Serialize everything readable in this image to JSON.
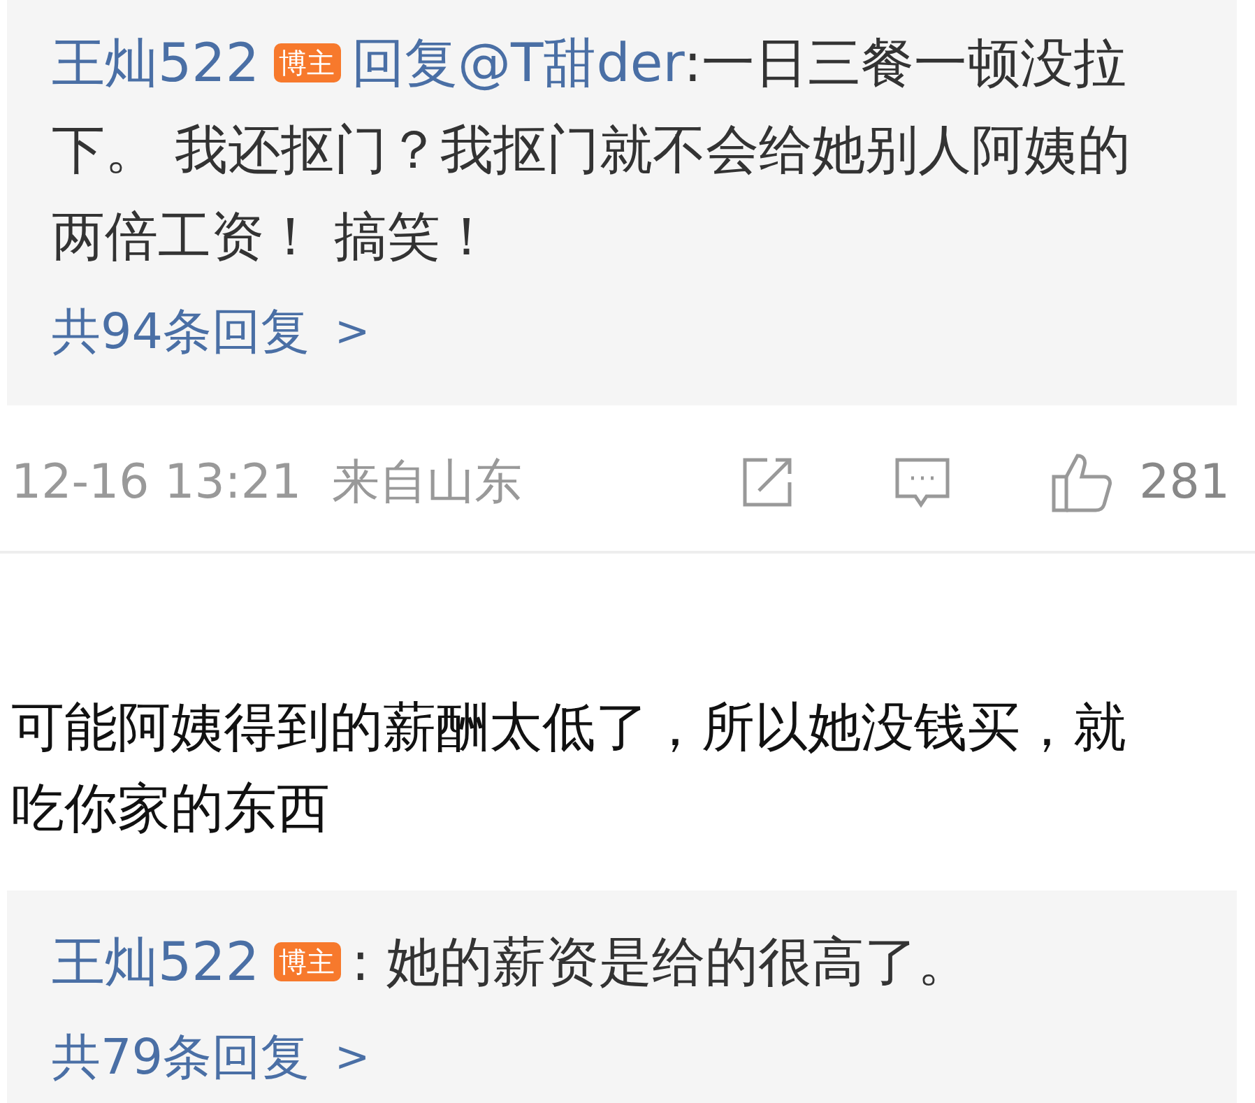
{
  "top_thread": {
    "replies": [
      {
        "author": "王灿522",
        "badge": "博主",
        "reply_word": "回复",
        "mention": "@T甜der",
        "text": ":一日三餐一顿没拉下。 我还抠门？我抠门就不会给她别人阿姨的两倍工资！ 搞笑！"
      }
    ],
    "more": "共94条回复",
    "more_arrow": ">"
  },
  "meta": {
    "time": "12-16 13:21",
    "location": "来自山东",
    "likes": "281"
  },
  "comment": {
    "text": "可能阿姨得到的薪酬太低了，所以她没钱买，就吃你家的东西"
  },
  "bottom_thread": {
    "replies": [
      {
        "author": "王灿522",
        "badge": "博主",
        "text": ": 她的薪资是给的很高了。"
      }
    ],
    "more": "共79条回复",
    "more_arrow": ">"
  }
}
